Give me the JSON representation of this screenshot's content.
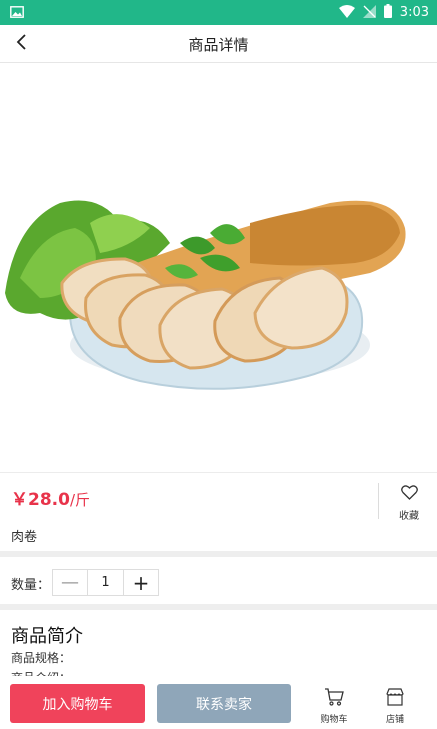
{
  "status_bar": {
    "time": "3:03",
    "background": "#21b789"
  },
  "nav": {
    "title": "商品详情"
  },
  "product": {
    "price": "￥28.0",
    "unit": "/斤",
    "name": "肉卷",
    "favorite_label": "收藏",
    "price_color": "#e8334a"
  },
  "quantity": {
    "label": "数量：",
    "value": "1",
    "minus": "—",
    "plus": "+"
  },
  "intro": {
    "title": "商品简介",
    "spec_label": "商品规格：",
    "desc_label": "商品介绍："
  },
  "bottom": {
    "add_to_cart": "加入购物车",
    "contact_seller": "联系卖家",
    "cart_tab": "购物车",
    "shop_tab": "店铺",
    "add_color": "#f0435b",
    "contact_color": "#8fa6b9"
  }
}
